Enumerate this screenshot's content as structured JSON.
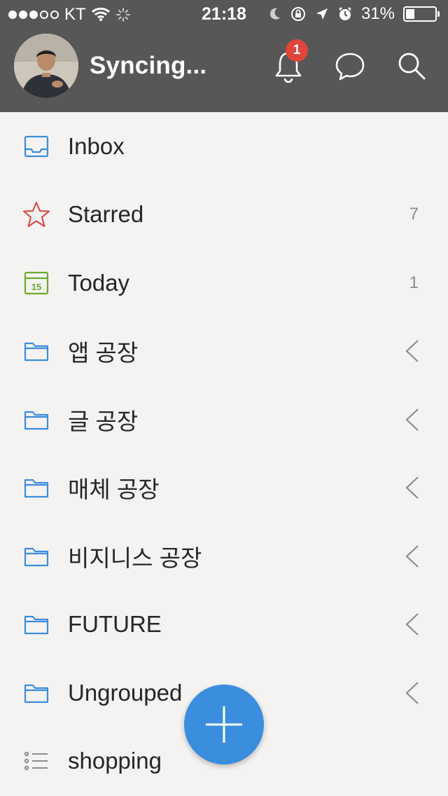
{
  "status_bar": {
    "carrier": "KT",
    "time": "21:18",
    "battery_percent_label": "31%",
    "battery_level": 0.31,
    "signal_dots_filled": 3,
    "signal_dots_total": 5
  },
  "header": {
    "account_name": "Syncing...",
    "notification_count": "1",
    "background_color": "#575757",
    "badge_color": "#e0443a"
  },
  "list": {
    "items": [
      {
        "label": "Inbox",
        "icon": "inbox-icon",
        "count": ""
      },
      {
        "label": "Starred",
        "icon": "star-icon",
        "count": "7"
      },
      {
        "label": "Today",
        "icon": "calendar-icon",
        "count": "1",
        "calendar_day": "15"
      },
      {
        "label": "앱 공장",
        "icon": "folder-icon"
      },
      {
        "label": "글 공장",
        "icon": "folder-icon"
      },
      {
        "label": "매체 공장",
        "icon": "folder-icon"
      },
      {
        "label": "비지니스 공장",
        "icon": "folder-icon"
      },
      {
        "label": "FUTURE",
        "icon": "folder-icon"
      },
      {
        "label": "Ungrouped",
        "icon": "folder-icon"
      },
      {
        "label": "shopping",
        "icon": "list-icon"
      }
    ]
  },
  "colors": {
    "accent_blue": "#3b8ddd",
    "star_red": "#d9433b",
    "today_green": "#6aab2e"
  }
}
